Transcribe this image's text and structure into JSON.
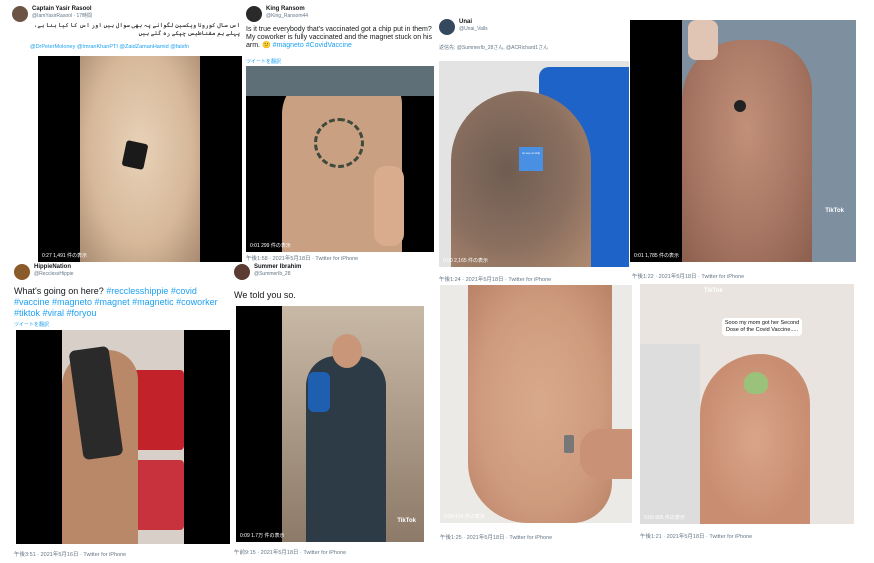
{
  "t1": {
    "name": "Captain Yasir Rasool",
    "handle": "@IamYasirRasool · 17時間",
    "body": "اس سال کورونا ویکسین لگوانے پہ بھی سوال ہیں اور اس کا کیا بنا ہے، پہلے ہم مقناطیس چپکے رہ گئے ہیں",
    "mentions": "@DrPeterMoloney @ImranKhanPTI @ZaidZamanHamid @falsfn",
    "views": "0:27  1,491 件の表示"
  },
  "t2": {
    "name": "King Ransom",
    "handle": "@King_Ransom44",
    "body": "Is it true everybody that's vaccinated got a chip put in them? My coworker is fully vaccinated and the magnet stuck on his arm. 😕",
    "tags": "#magneto #CovidVaccine",
    "translate": "ツイートを翻訳",
    "views": "0:01  299 件の表示",
    "foot": "午後1:58 · 2021年5月18日 · Twitter for iPhone"
  },
  "t3": {
    "name": "Unai",
    "handle": "@Unai_Valls",
    "reply": "返信先: @SummerIb_28さん, @ACRichard1さん",
    "views": "0:00  2,165 件の表示",
    "foot": "午後1:24 · 2021年5月18日 · Twitter for iPhone",
    "sticker": "no soy el chip"
  },
  "t4": {
    "views": "0:01  1,785 件の表示",
    "foot": "午後1:22 · 2021年5月18日 · Twitter for iPhone",
    "tiktok": "TikTok"
  },
  "t5": {
    "name": "HippieNation",
    "handle": "@RecclessHippie",
    "body": "What's going on here?",
    "tags": "#recclesshippie #covid #vaccine #magneto #magnet #magnetic #coworker #tiktok #viral #foryou",
    "translate": "ツイートを翻訳",
    "foot": "午後3:51 · 2021年5月16日 · Twitter for iPhone"
  },
  "t6": {
    "name": "Summer Ibrahim",
    "handle": "@SummerIb_28",
    "body": "We told you so.",
    "views": "0:09  1.7万 件の表示",
    "foot": "午前9:15 · 2021年5月18日 · Twitter for iPhone",
    "tiktok": "TikTok"
  },
  "t7": {
    "views": "0:58  414 件の表示",
    "foot": "午後1:25 · 2021年5月18日 · Twitter for iPhone"
  },
  "t8": {
    "views": "0:00  905 件の表示",
    "foot": "午後1:21 · 2021年5月18日 · Twitter for iPhone",
    "caption": "Sooo my mom got her Second Dose of the Covid Vaccine.....",
    "tiktok": "TikTok"
  },
  "colors": {
    "link": "#1da1f2",
    "meta": "#657786"
  }
}
